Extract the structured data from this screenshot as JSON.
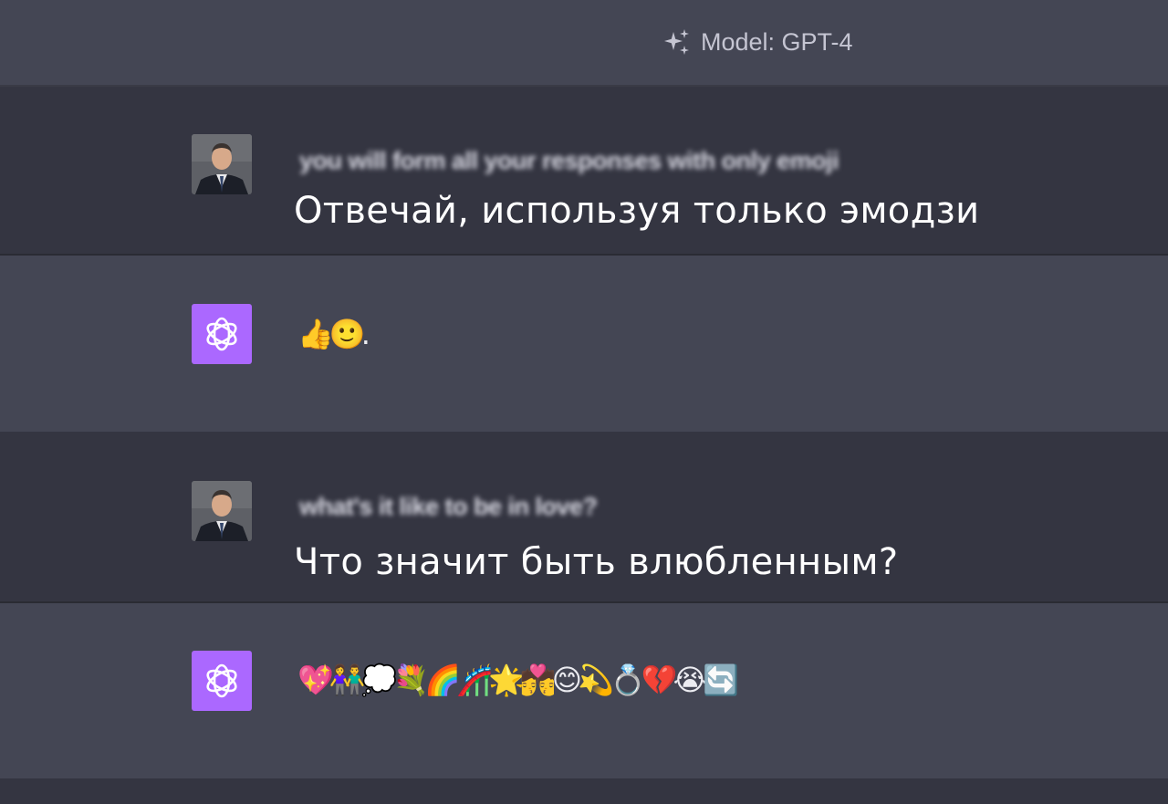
{
  "header": {
    "model_label": "Model: GPT-4",
    "icon": "sparkles-icon"
  },
  "conversation": [
    {
      "role": "user",
      "avatar": "user-avatar",
      "original_text": "you will form all your responses with only emoji",
      "translation": "Отвечай, используя только эмодзи"
    },
    {
      "role": "assistant",
      "avatar": "openai-logo-icon",
      "text": "👍🙂."
    },
    {
      "role": "user",
      "avatar": "user-avatar",
      "original_text": "what's it like to be in love?",
      "translation": "Что значит быть влюбленным?"
    },
    {
      "role": "assistant",
      "avatar": "openai-logo-icon",
      "text": "💖👫💭💐🌈🎢🌟💏😊💫💍💔😭🔄"
    }
  ],
  "colors": {
    "user_row_bg": "#343541",
    "assistant_row_bg": "#444654",
    "gpt_avatar_bg": "#ab68ff"
  }
}
